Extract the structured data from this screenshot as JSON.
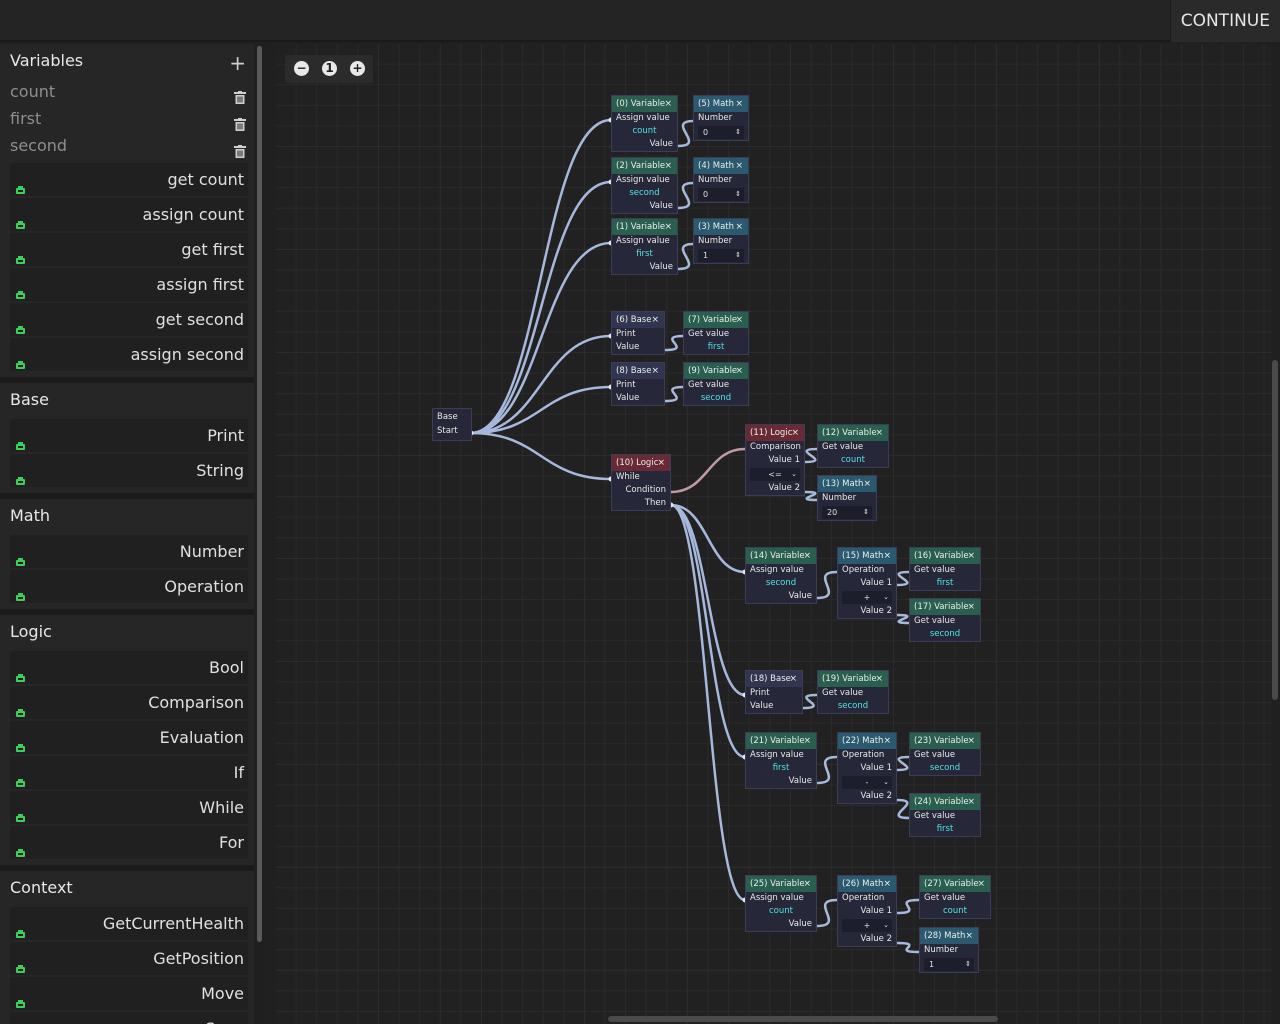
{
  "topbar": {
    "continue_label": "CONTINUE"
  },
  "sidebar": {
    "variables_title": "Variables",
    "add_label": "+",
    "variables": [
      "count",
      "first",
      "second"
    ],
    "var_blocks": [
      "get count",
      "assign count",
      "get first",
      "assign first",
      "get second",
      "assign second"
    ],
    "sections": [
      {
        "title": "Base",
        "items": [
          "Print",
          "String"
        ]
      },
      {
        "title": "Math",
        "items": [
          "Number",
          "Operation"
        ]
      },
      {
        "title": "Logic",
        "items": [
          "Bool",
          "Comparison",
          "Evaluation",
          "If",
          "While",
          "For"
        ]
      },
      {
        "title": "Context",
        "items": [
          "GetCurrentHealth",
          "GetPosition",
          "Move",
          "Scan"
        ]
      }
    ]
  },
  "zoom": {
    "minus": "−",
    "level": "1",
    "plus": "+"
  },
  "colors": {
    "variable": "#2a5e4f",
    "math": "#2b5970",
    "base": "#323550",
    "logic": "#6a2a35",
    "wire": "#a6b8dc",
    "wire_logic": "#c09aa2",
    "accent_text": "#4fe4e4"
  },
  "nodes": [
    {
      "id": "start",
      "type": "base",
      "title": "Base",
      "rows": [
        "Start"
      ]
    },
    {
      "id": "n0",
      "type": "var",
      "title": "(0) Variable",
      "rows": [
        "Assign value",
        "count",
        "Value"
      ]
    },
    {
      "id": "n5",
      "type": "math",
      "title": "(5) Math",
      "rows": [
        "Number"
      ],
      "value": "0"
    },
    {
      "id": "n2",
      "type": "var",
      "title": "(2) Variable",
      "rows": [
        "Assign value",
        "second",
        "Value"
      ]
    },
    {
      "id": "n4",
      "type": "math",
      "title": "(4) Math",
      "rows": [
        "Number"
      ],
      "value": "0"
    },
    {
      "id": "n1",
      "type": "var",
      "title": "(1) Variable",
      "rows": [
        "Assign value",
        "first",
        "Value"
      ]
    },
    {
      "id": "n3",
      "type": "math",
      "title": "(3) Math",
      "rows": [
        "Number"
      ],
      "value": "1"
    },
    {
      "id": "n6",
      "type": "base",
      "title": "(6) Base",
      "rows": [
        "Print",
        "Value"
      ]
    },
    {
      "id": "n7",
      "type": "var",
      "title": "(7) Variable",
      "rows": [
        "Get value",
        "first"
      ]
    },
    {
      "id": "n8",
      "type": "base",
      "title": "(8) Base",
      "rows": [
        "Print",
        "Value"
      ]
    },
    {
      "id": "n9",
      "type": "var",
      "title": "(9) Variable",
      "rows": [
        "Get value",
        "second"
      ]
    },
    {
      "id": "n10",
      "type": "logic",
      "title": "(10) Logic",
      "rows": [
        "While",
        "Condition",
        "Then"
      ]
    },
    {
      "id": "n11",
      "type": "logic",
      "title": "(11) Logic",
      "rows": [
        "Comparison",
        "Value 1",
        "Value 2"
      ],
      "select": "<="
    },
    {
      "id": "n12",
      "type": "var",
      "title": "(12) Variable",
      "rows": [
        "Get value",
        "count"
      ]
    },
    {
      "id": "n13",
      "type": "math",
      "title": "(13) Math",
      "rows": [
        "Number"
      ],
      "value": "20"
    },
    {
      "id": "n14",
      "type": "var",
      "title": "(14) Variable",
      "rows": [
        "Assign value",
        "second",
        "Value"
      ]
    },
    {
      "id": "n15",
      "type": "math",
      "title": "(15) Math",
      "rows": [
        "Operation",
        "Value 1",
        "Value 2"
      ],
      "select": "+"
    },
    {
      "id": "n16",
      "type": "var",
      "title": "(16) Variable",
      "rows": [
        "Get value",
        "first"
      ]
    },
    {
      "id": "n17",
      "type": "var",
      "title": "(17) Variable",
      "rows": [
        "Get value",
        "second"
      ]
    },
    {
      "id": "n18",
      "type": "base",
      "title": "(18) Base",
      "rows": [
        "Print",
        "Value"
      ]
    },
    {
      "id": "n19",
      "type": "var",
      "title": "(19) Variable",
      "rows": [
        "Get value",
        "second"
      ]
    },
    {
      "id": "n21",
      "type": "var",
      "title": "(21) Variable",
      "rows": [
        "Assign value",
        "first",
        "Value"
      ]
    },
    {
      "id": "n22",
      "type": "math",
      "title": "(22) Math",
      "rows": [
        "Operation",
        "Value 1",
        "Value 2"
      ],
      "select": "-"
    },
    {
      "id": "n23",
      "type": "var",
      "title": "(23) Variable",
      "rows": [
        "Get value",
        "second"
      ]
    },
    {
      "id": "n24",
      "type": "var",
      "title": "(24) Variable",
      "rows": [
        "Get value",
        "first"
      ]
    },
    {
      "id": "n25",
      "type": "var",
      "title": "(25) Variable",
      "rows": [
        "Assign value",
        "count",
        "Value"
      ]
    },
    {
      "id": "n26",
      "type": "math",
      "title": "(26) Math",
      "rows": [
        "Operation",
        "Value 1",
        "Value 2"
      ],
      "select": "+"
    },
    {
      "id": "n27",
      "type": "var",
      "title": "(27) Variable",
      "rows": [
        "Get value",
        "count"
      ]
    },
    {
      "id": "n28",
      "type": "math",
      "title": "(28) Math",
      "rows": [
        "Number"
      ],
      "value": "1"
    }
  ]
}
